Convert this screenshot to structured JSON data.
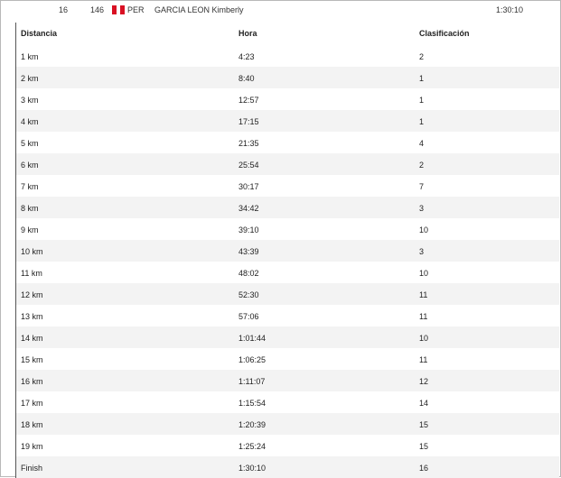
{
  "athlete": {
    "position": "16",
    "bib": "146",
    "country": "PER",
    "name": "GARCIA LEON Kimberly",
    "time": "1:30:10",
    "flag_colors": [
      "#d91023",
      "#ffffff",
      "#d91023"
    ]
  },
  "table": {
    "headers": [
      "Distancia",
      "Hora",
      "Clasificación"
    ],
    "rows": [
      {
        "distance": "1 km",
        "time": "4:23",
        "rank": "2"
      },
      {
        "distance": "2 km",
        "time": "8:40",
        "rank": "1"
      },
      {
        "distance": "3 km",
        "time": "12:57",
        "rank": "1"
      },
      {
        "distance": "4 km",
        "time": "17:15",
        "rank": "1"
      },
      {
        "distance": "5 km",
        "time": "21:35",
        "rank": "4"
      },
      {
        "distance": "6 km",
        "time": "25:54",
        "rank": "2"
      },
      {
        "distance": "7 km",
        "time": "30:17",
        "rank": "7"
      },
      {
        "distance": "8 km",
        "time": "34:42",
        "rank": "3"
      },
      {
        "distance": "9 km",
        "time": "39:10",
        "rank": "10"
      },
      {
        "distance": "10 km",
        "time": "43:39",
        "rank": "3"
      },
      {
        "distance": "11 km",
        "time": "48:02",
        "rank": "10"
      },
      {
        "distance": "12 km",
        "time": "52:30",
        "rank": "11"
      },
      {
        "distance": "13 km",
        "time": "57:06",
        "rank": "11"
      },
      {
        "distance": "14 km",
        "time": "1:01:44",
        "rank": "10"
      },
      {
        "distance": "15 km",
        "time": "1:06:25",
        "rank": "11"
      },
      {
        "distance": "16 km",
        "time": "1:11:07",
        "rank": "12"
      },
      {
        "distance": "17 km",
        "time": "1:15:54",
        "rank": "14"
      },
      {
        "distance": "18 km",
        "time": "1:20:39",
        "rank": "15"
      },
      {
        "distance": "19 km",
        "time": "1:25:24",
        "rank": "15"
      },
      {
        "distance": "Finish",
        "time": "1:30:10",
        "rank": "16"
      }
    ]
  }
}
